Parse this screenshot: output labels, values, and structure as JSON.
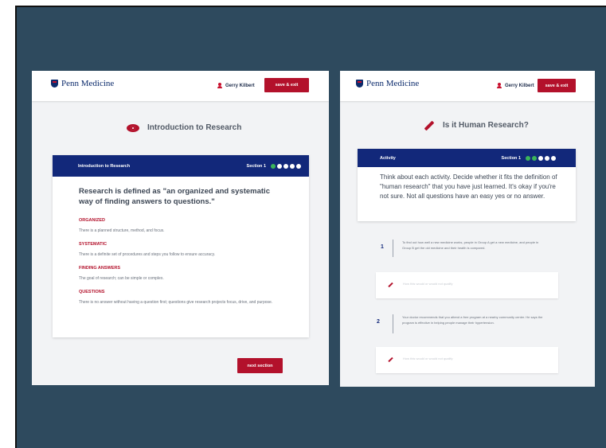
{
  "screen_left": {
    "brand": "Penn Medicine",
    "user_name": "Gerry Kilbert",
    "save_exit_label": "save & exit",
    "page_title": "Introduction to Research",
    "card_title": "Introduction to Research",
    "section_label": "Section 1",
    "progress": {
      "completed": 1,
      "total": 5
    },
    "lead": "Research is defined as \"an organized and systematic way of finding answers to questions.\"",
    "terms": [
      {
        "term": "ORGANIZED",
        "definition": "There is a planned structure, method, and focus."
      },
      {
        "term": "SYSTEMATIC",
        "definition": "There is a definite set of procedures and steps you follow to ensure accuracy."
      },
      {
        "term": "FINDING ANSWERS",
        "definition": "The goal of research; can be simple or complex."
      },
      {
        "term": "QUESTIONS",
        "definition": "There is no answer without having a question first; questions give research projects focus, drive, and purpose."
      }
    ],
    "next_label": "next section"
  },
  "screen_right": {
    "brand": "Penn Medicine",
    "user_name": "Gerry Kilbert",
    "save_exit_label": "save & exit",
    "page_title": "Is it Human Research?",
    "card_title": "Activity",
    "section_label": "Section 1",
    "progress": {
      "completed": 2,
      "total": 5
    },
    "activity_text": "Think about each activity. Decide whether it fits the definition of \"human research\" that you have just learned. It's okay if you're not sure. Not all questions have an easy yes or no answer.",
    "questions": [
      {
        "number": "1",
        "text": "To find out how well a new medicine works, people in Group A get a new medicine, and people in Group B get the old medicine and their health is compared.",
        "placeholder": "How this would or would not qualify"
      },
      {
        "number": "2",
        "text": "Your doctor recommends that you attend a free program at a nearby community center. He says the program is effective in helping people manage their hypertension.",
        "placeholder": "How this would or would not qualify"
      }
    ]
  },
  "colors": {
    "backdrop": "#2e4a5e",
    "brand_navy": "#12287a",
    "accent_red": "#b3112b",
    "progress_green": "#3bb55a"
  }
}
